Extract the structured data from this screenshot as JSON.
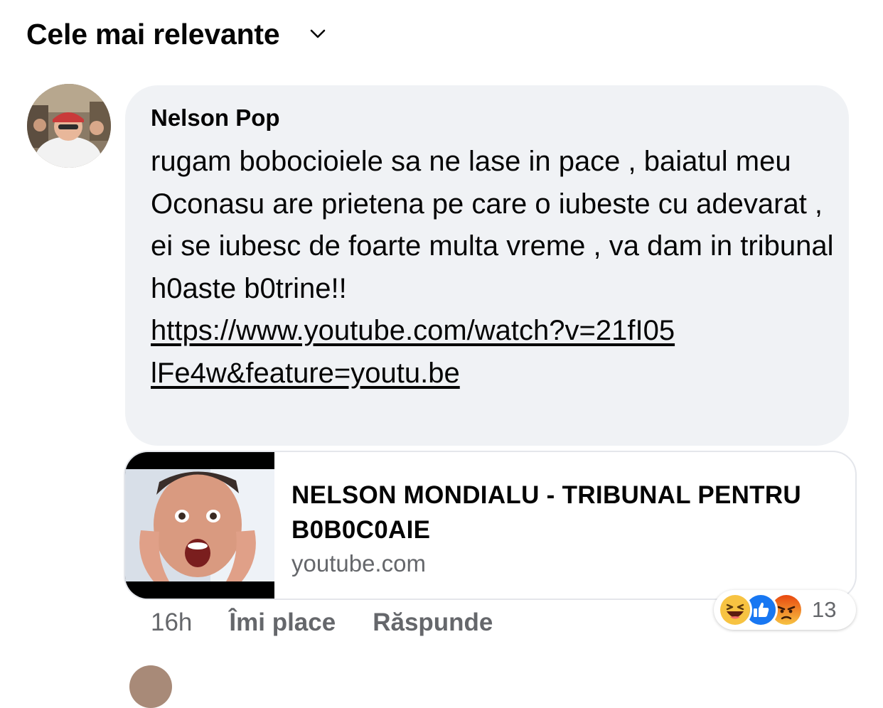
{
  "sort": {
    "label": "Cele mai relevante",
    "icon": "chevron-down-icon"
  },
  "comment": {
    "author": "Nelson Pop",
    "text": "rugam bobocioiele sa ne lase in pace , baiatul meu Oconasu are prietena pe care o iubeste cu adevarat , ei se iubesc de foarte multa vreme , va dam in tribunal h0aste b0trine!!",
    "link": "https://www.youtube.com/watch?v=21fI05lFe4w&feature=youtu.be",
    "time": "16h",
    "like_label": "Îmi place",
    "reply_label": "Răspunde",
    "reactions": {
      "icons": [
        "haha-icon",
        "like-icon",
        "angry-icon"
      ],
      "count": "13"
    }
  },
  "link_preview": {
    "title": "NELSON MONDIALU - TRIBUNAL PENTRU B0B0C0AIE",
    "domain": "youtube.com"
  },
  "colors": {
    "bubble": "#f0f2f5",
    "secondary_text": "#65676b",
    "like_blue": "#1877f2",
    "haha_yellow": "#f7c342",
    "angry_orange": "#e9710f"
  }
}
